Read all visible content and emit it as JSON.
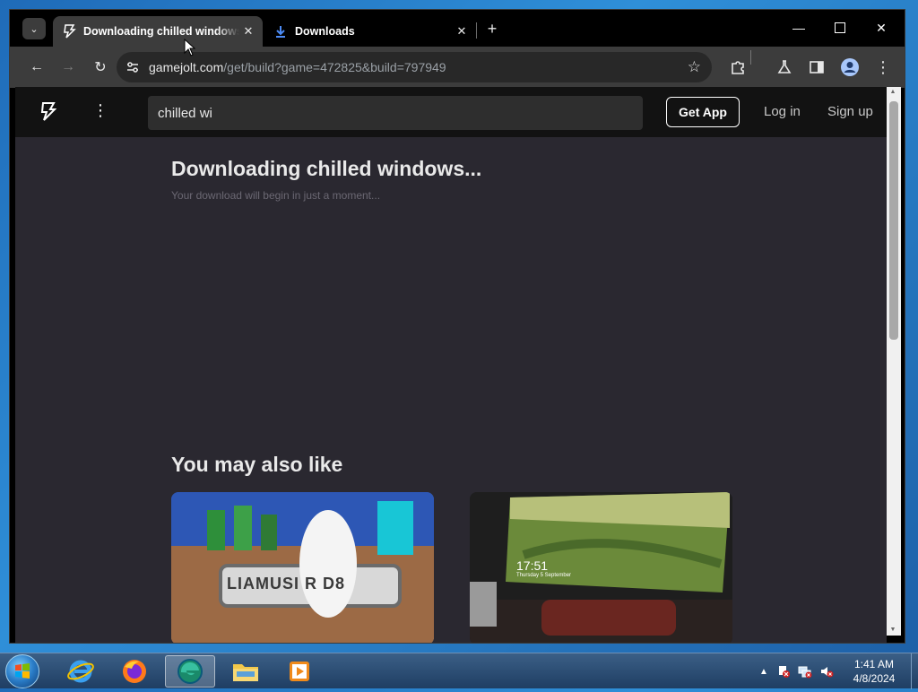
{
  "browser": {
    "tabs": [
      {
        "title": "Downloading chilled windows...",
        "icon": "gamejolt-bolt-icon",
        "active": true
      },
      {
        "title": "Downloads",
        "icon": "download-icon",
        "active": false
      }
    ],
    "address": {
      "host": "gamejolt.com",
      "path": "/get/build?game=472825&build=797949"
    }
  },
  "site": {
    "search_value": "chilled wi",
    "get_app_label": "Get App",
    "login_label": "Log in",
    "signup_label": "Sign up"
  },
  "download": {
    "title": "Downloading chilled windows...",
    "subtitle": "Your download will begin in just a moment..."
  },
  "recommendations": {
    "title": "You may also like",
    "card2_time": "17:51",
    "card2_date": "Thursday 5 September"
  },
  "card1_text": "LIAMUSI R D8",
  "taskbar": {
    "time": "1:41 AM",
    "date": "4/8/2024"
  },
  "colors": {
    "page_bg": "#2a2830",
    "header_bg": "#121212",
    "accent_download": "#4c8bf5"
  }
}
